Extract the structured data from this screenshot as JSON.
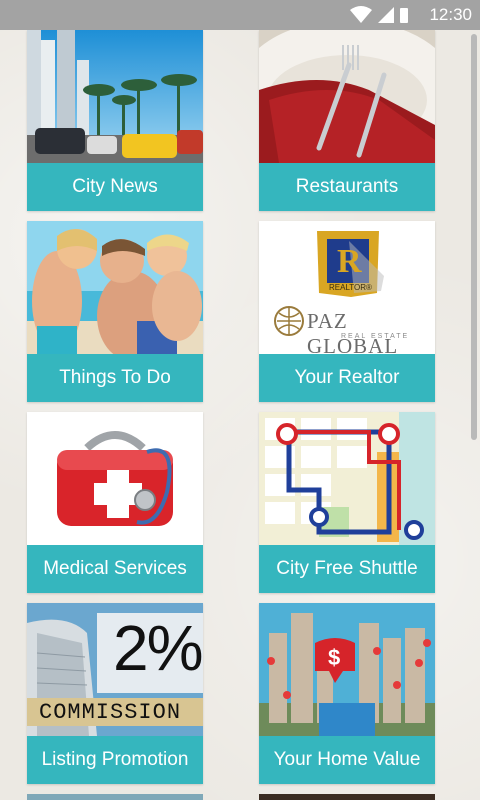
{
  "status_bar": {
    "time": "12:30"
  },
  "tiles": [
    {
      "label": "City News"
    },
    {
      "label": "Restaurants"
    },
    {
      "label": "Things To Do"
    },
    {
      "label": "Your Realtor"
    },
    {
      "label": "Medical Services"
    },
    {
      "label": "City Free Shuttle"
    },
    {
      "label": "Listing Promotion"
    },
    {
      "label": "Your Home Value"
    }
  ],
  "realtor_logo": {
    "badge_letter": "R",
    "badge_text": "REALTOR®",
    "company": "PAZ GLOBAL",
    "company_sub": "REAL ESTATE"
  },
  "promo": {
    "percent": "2%",
    "word": "COMMISSION"
  },
  "colors": {
    "accent": "#35b6be",
    "status_bar": "#a3a3a3",
    "background": "#ece9e3"
  }
}
